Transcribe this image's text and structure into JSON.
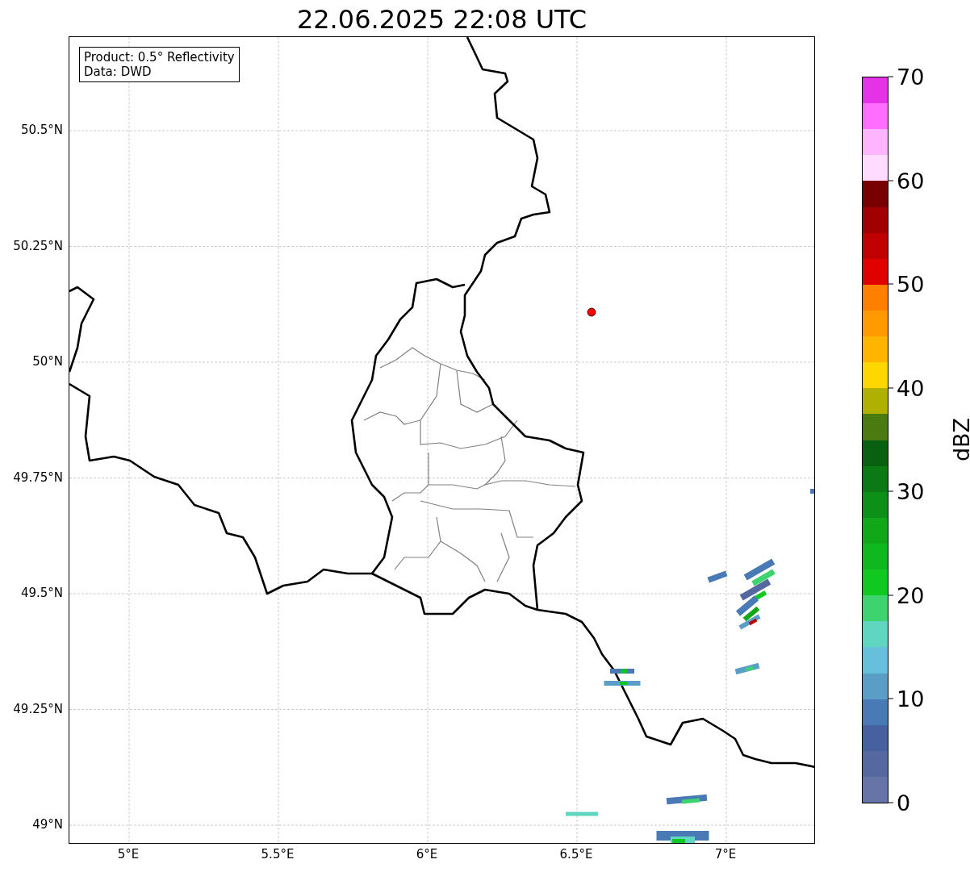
{
  "title": "22.06.2025 22:08 UTC",
  "info_box": [
    "Product: 0.5° Reflectivity",
    "Data: DWD"
  ],
  "lat_ticks": [
    "50.5°N",
    "50.25°N",
    "50°N",
    "49.75°N",
    "49.5°N",
    "49.25°N",
    "49°N"
  ],
  "lon_ticks": [
    "5°E",
    "5.5°E",
    "6°E",
    "6.5°E",
    "7°E"
  ],
  "colorbar": {
    "label": "dBZ",
    "ticks": [
      "70",
      "60",
      "50",
      "40",
      "30",
      "20",
      "10",
      "0"
    ],
    "segments": [
      {
        "color": "#e632e6"
      },
      {
        "color": "#ff6eff"
      },
      {
        "color": "#ffb4ff"
      },
      {
        "color": "#ffdcff"
      },
      {
        "color": "#780000"
      },
      {
        "color": "#a00000"
      },
      {
        "color": "#c00000"
      },
      {
        "color": "#e00000"
      },
      {
        "color": "#ff8000"
      },
      {
        "color": "#ff9b00"
      },
      {
        "color": "#ffb400"
      },
      {
        "color": "#ffd700"
      },
      {
        "color": "#b0b000"
      },
      {
        "color": "#4a7a10"
      },
      {
        "color": "#086010"
      },
      {
        "color": "#0c7a14"
      },
      {
        "color": "#0c9018"
      },
      {
        "color": "#10a818"
      },
      {
        "color": "#10b820"
      },
      {
        "color": "#10c820"
      },
      {
        "color": "#3dd470"
      },
      {
        "color": "#60d6c0"
      },
      {
        "color": "#66c0dc"
      },
      {
        "color": "#5a9ec8"
      },
      {
        "color": "#4a7ab5"
      },
      {
        "color": "#4660a0"
      },
      {
        "color": "#5668a0"
      },
      {
        "color": "#6674a8"
      }
    ]
  }
}
